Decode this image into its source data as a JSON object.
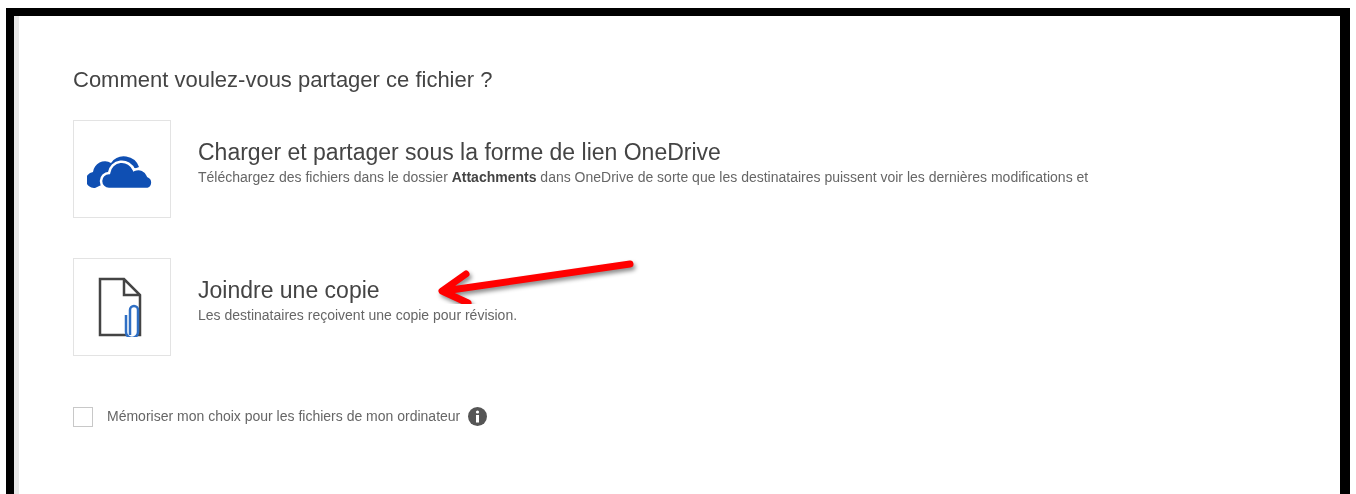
{
  "heading": "Comment voulez-vous partager ce fichier ?",
  "options": [
    {
      "kind": "cloud",
      "title": "Charger et partager sous la forme de lien OneDrive",
      "description": "Téléchargez des fichiers dans le dossier **Attachments** dans OneDrive de sorte que les destinataires puissent voir les dernières modifications et"
    },
    {
      "kind": "attachment",
      "title": "Joindre une copie",
      "description": "Les destinataires reçoivent une copie pour révision."
    }
  ],
  "remember": {
    "label": "Mémoriser mon choix pour les fichiers de mon ordinateur",
    "checked": false
  }
}
